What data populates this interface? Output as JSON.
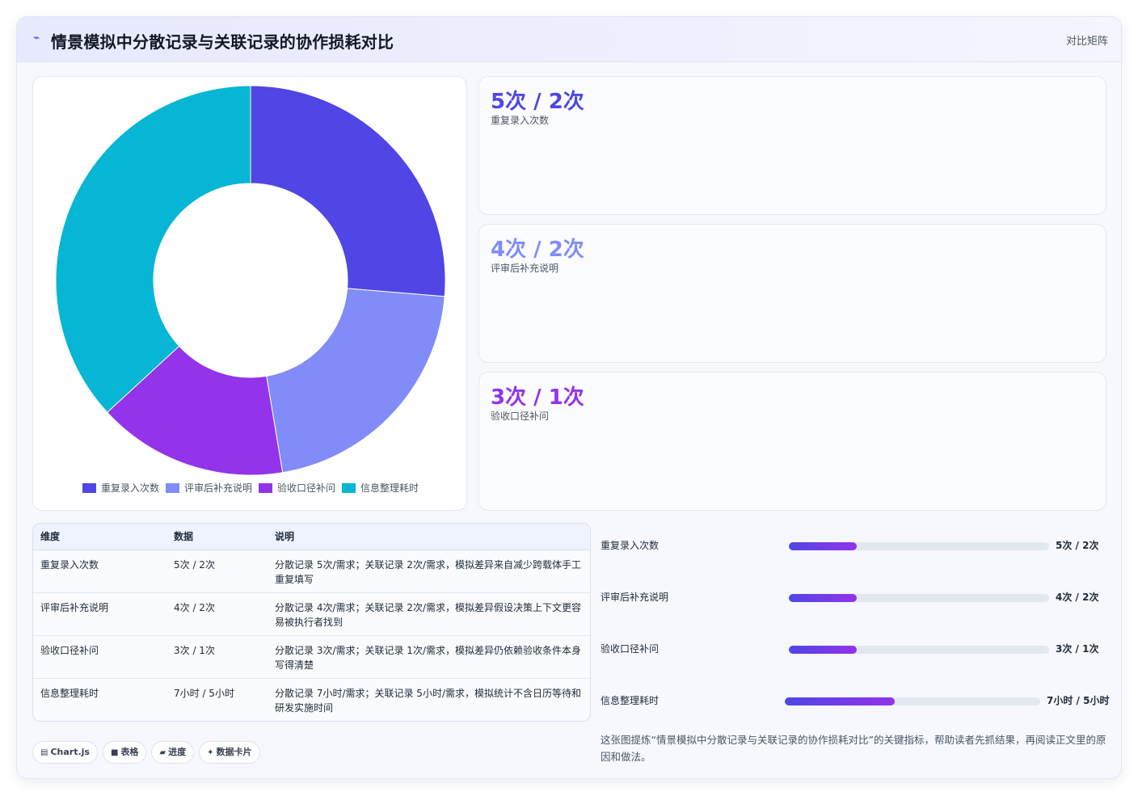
{
  "header": {
    "icon": "sparkle-line-icon",
    "title": "情景模拟中分散记录与关联记录的协作损耗对比",
    "badge": "对比矩阵"
  },
  "chart_data": {
    "type": "pie",
    "donut": true,
    "categories": [
      "重复录入次数",
      "评审后补充说明",
      "验收口径补问",
      "信息整理耗时"
    ],
    "values": [
      5,
      4,
      3,
      7
    ],
    "colors": [
      "#4f46e5",
      "#818cf8",
      "#9333ea",
      "#06b6d4"
    ],
    "legend": "bottom"
  },
  "stats": [
    {
      "value": "5次 / 2次",
      "label": "重复录入次数",
      "color": "#4f46e5"
    },
    {
      "value": "4次 / 2次",
      "label": "评审后补充说明",
      "color": "#818cf8"
    },
    {
      "value": "3次 / 1次",
      "label": "验收口径补问",
      "color": "#9333ea"
    }
  ],
  "table": {
    "headers": [
      "维度",
      "数据",
      "说明"
    ],
    "rows": [
      [
        "重复录入次数",
        "5次 / 2次",
        "分散记录 5次/需求；关联记录 2次/需求，模拟差异来自减少跨载体手工重复填写"
      ],
      [
        "评审后补充说明",
        "4次 / 2次",
        "分散记录 4次/需求；关联记录 2次/需求，模拟差异假设决策上下文更容易被执行者找到"
      ],
      [
        "验收口径补问",
        "3次 / 1次",
        "分散记录 3次/需求；关联记录 1次/需求，模拟差异仍依赖验收条件本身写得清楚"
      ],
      [
        "信息整理耗时",
        "7小时 / 5小时",
        "分散记录 7小时/需求；关联记录 5小时/需求，模拟统计不含日历等待和研发实施时间"
      ]
    ]
  },
  "progress": [
    {
      "label": "重复录入次数",
      "value": "5次 / 2次",
      "fraction": 0.26
    },
    {
      "label": "评审后补充说明",
      "value": "4次 / 2次",
      "fraction": 0.26
    },
    {
      "label": "验收口径补问",
      "value": "3次 / 1次",
      "fraction": 0.26
    },
    {
      "label": "信息整理耗时",
      "value": "7小时 / 5小时",
      "fraction": 0.43
    }
  ],
  "tags": [
    {
      "icon": "chart-icon",
      "glyph": "▤",
      "label": "Chart.js"
    },
    {
      "icon": "table-icon",
      "glyph": "■",
      "label": "表格"
    },
    {
      "icon": "progress-icon",
      "glyph": "▰",
      "label": "进度"
    },
    {
      "icon": "card-icon",
      "glyph": "✦",
      "label": "数据卡片"
    }
  ],
  "footnote": "这张图提炼“情景模拟中分散记录与关联记录的协作损耗对比”的关键指标，帮助读者先抓结果，再阅读正文里的原因和做法。"
}
